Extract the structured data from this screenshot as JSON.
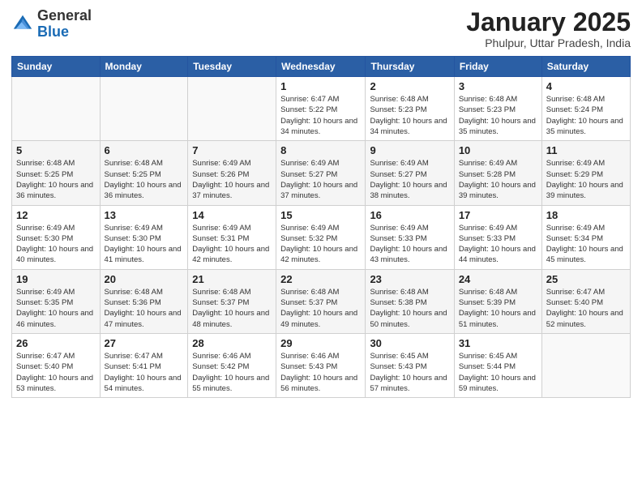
{
  "logo": {
    "general": "General",
    "blue": "Blue"
  },
  "title": {
    "month": "January 2025",
    "location": "Phulpur, Uttar Pradesh, India"
  },
  "weekdays": [
    "Sunday",
    "Monday",
    "Tuesday",
    "Wednesday",
    "Thursday",
    "Friday",
    "Saturday"
  ],
  "weeks": [
    [
      {
        "day": "",
        "sunrise": "",
        "sunset": "",
        "daylight": ""
      },
      {
        "day": "",
        "sunrise": "",
        "sunset": "",
        "daylight": ""
      },
      {
        "day": "",
        "sunrise": "",
        "sunset": "",
        "daylight": ""
      },
      {
        "day": "1",
        "sunrise": "Sunrise: 6:47 AM",
        "sunset": "Sunset: 5:22 PM",
        "daylight": "Daylight: 10 hours and 34 minutes."
      },
      {
        "day": "2",
        "sunrise": "Sunrise: 6:48 AM",
        "sunset": "Sunset: 5:23 PM",
        "daylight": "Daylight: 10 hours and 34 minutes."
      },
      {
        "day": "3",
        "sunrise": "Sunrise: 6:48 AM",
        "sunset": "Sunset: 5:23 PM",
        "daylight": "Daylight: 10 hours and 35 minutes."
      },
      {
        "day": "4",
        "sunrise": "Sunrise: 6:48 AM",
        "sunset": "Sunset: 5:24 PM",
        "daylight": "Daylight: 10 hours and 35 minutes."
      }
    ],
    [
      {
        "day": "5",
        "sunrise": "Sunrise: 6:48 AM",
        "sunset": "Sunset: 5:25 PM",
        "daylight": "Daylight: 10 hours and 36 minutes."
      },
      {
        "day": "6",
        "sunrise": "Sunrise: 6:48 AM",
        "sunset": "Sunset: 5:25 PM",
        "daylight": "Daylight: 10 hours and 36 minutes."
      },
      {
        "day": "7",
        "sunrise": "Sunrise: 6:49 AM",
        "sunset": "Sunset: 5:26 PM",
        "daylight": "Daylight: 10 hours and 37 minutes."
      },
      {
        "day": "8",
        "sunrise": "Sunrise: 6:49 AM",
        "sunset": "Sunset: 5:27 PM",
        "daylight": "Daylight: 10 hours and 37 minutes."
      },
      {
        "day": "9",
        "sunrise": "Sunrise: 6:49 AM",
        "sunset": "Sunset: 5:27 PM",
        "daylight": "Daylight: 10 hours and 38 minutes."
      },
      {
        "day": "10",
        "sunrise": "Sunrise: 6:49 AM",
        "sunset": "Sunset: 5:28 PM",
        "daylight": "Daylight: 10 hours and 39 minutes."
      },
      {
        "day": "11",
        "sunrise": "Sunrise: 6:49 AM",
        "sunset": "Sunset: 5:29 PM",
        "daylight": "Daylight: 10 hours and 39 minutes."
      }
    ],
    [
      {
        "day": "12",
        "sunrise": "Sunrise: 6:49 AM",
        "sunset": "Sunset: 5:30 PM",
        "daylight": "Daylight: 10 hours and 40 minutes."
      },
      {
        "day": "13",
        "sunrise": "Sunrise: 6:49 AM",
        "sunset": "Sunset: 5:30 PM",
        "daylight": "Daylight: 10 hours and 41 minutes."
      },
      {
        "day": "14",
        "sunrise": "Sunrise: 6:49 AM",
        "sunset": "Sunset: 5:31 PM",
        "daylight": "Daylight: 10 hours and 42 minutes."
      },
      {
        "day": "15",
        "sunrise": "Sunrise: 6:49 AM",
        "sunset": "Sunset: 5:32 PM",
        "daylight": "Daylight: 10 hours and 42 minutes."
      },
      {
        "day": "16",
        "sunrise": "Sunrise: 6:49 AM",
        "sunset": "Sunset: 5:33 PM",
        "daylight": "Daylight: 10 hours and 43 minutes."
      },
      {
        "day": "17",
        "sunrise": "Sunrise: 6:49 AM",
        "sunset": "Sunset: 5:33 PM",
        "daylight": "Daylight: 10 hours and 44 minutes."
      },
      {
        "day": "18",
        "sunrise": "Sunrise: 6:49 AM",
        "sunset": "Sunset: 5:34 PM",
        "daylight": "Daylight: 10 hours and 45 minutes."
      }
    ],
    [
      {
        "day": "19",
        "sunrise": "Sunrise: 6:49 AM",
        "sunset": "Sunset: 5:35 PM",
        "daylight": "Daylight: 10 hours and 46 minutes."
      },
      {
        "day": "20",
        "sunrise": "Sunrise: 6:48 AM",
        "sunset": "Sunset: 5:36 PM",
        "daylight": "Daylight: 10 hours and 47 minutes."
      },
      {
        "day": "21",
        "sunrise": "Sunrise: 6:48 AM",
        "sunset": "Sunset: 5:37 PM",
        "daylight": "Daylight: 10 hours and 48 minutes."
      },
      {
        "day": "22",
        "sunrise": "Sunrise: 6:48 AM",
        "sunset": "Sunset: 5:37 PM",
        "daylight": "Daylight: 10 hours and 49 minutes."
      },
      {
        "day": "23",
        "sunrise": "Sunrise: 6:48 AM",
        "sunset": "Sunset: 5:38 PM",
        "daylight": "Daylight: 10 hours and 50 minutes."
      },
      {
        "day": "24",
        "sunrise": "Sunrise: 6:48 AM",
        "sunset": "Sunset: 5:39 PM",
        "daylight": "Daylight: 10 hours and 51 minutes."
      },
      {
        "day": "25",
        "sunrise": "Sunrise: 6:47 AM",
        "sunset": "Sunset: 5:40 PM",
        "daylight": "Daylight: 10 hours and 52 minutes."
      }
    ],
    [
      {
        "day": "26",
        "sunrise": "Sunrise: 6:47 AM",
        "sunset": "Sunset: 5:40 PM",
        "daylight": "Daylight: 10 hours and 53 minutes."
      },
      {
        "day": "27",
        "sunrise": "Sunrise: 6:47 AM",
        "sunset": "Sunset: 5:41 PM",
        "daylight": "Daylight: 10 hours and 54 minutes."
      },
      {
        "day": "28",
        "sunrise": "Sunrise: 6:46 AM",
        "sunset": "Sunset: 5:42 PM",
        "daylight": "Daylight: 10 hours and 55 minutes."
      },
      {
        "day": "29",
        "sunrise": "Sunrise: 6:46 AM",
        "sunset": "Sunset: 5:43 PM",
        "daylight": "Daylight: 10 hours and 56 minutes."
      },
      {
        "day": "30",
        "sunrise": "Sunrise: 6:45 AM",
        "sunset": "Sunset: 5:43 PM",
        "daylight": "Daylight: 10 hours and 57 minutes."
      },
      {
        "day": "31",
        "sunrise": "Sunrise: 6:45 AM",
        "sunset": "Sunset: 5:44 PM",
        "daylight": "Daylight: 10 hours and 59 minutes."
      },
      {
        "day": "",
        "sunrise": "",
        "sunset": "",
        "daylight": ""
      }
    ]
  ]
}
